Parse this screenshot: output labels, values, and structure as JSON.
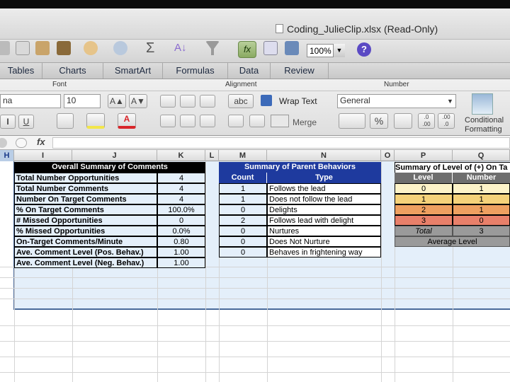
{
  "window": {
    "title": "Coding_JulieClip.xlsx  (Read-Only)"
  },
  "toolbar": {
    "zoom": "100%",
    "help": "?",
    "fx": "fx"
  },
  "tabs": [
    {
      "label": "Tables"
    },
    {
      "label": "Charts"
    },
    {
      "label": "SmartArt"
    },
    {
      "label": "Formulas"
    },
    {
      "label": "Data"
    },
    {
      "label": "Review"
    }
  ],
  "ribbon": {
    "groups": {
      "font": "Font",
      "alignment": "Alignment",
      "number": "Number"
    },
    "font_name": "na",
    "font_size": "10",
    "wrap_text": "Wrap Text",
    "merge": "Merge",
    "number_format": "General",
    "abc": "abc",
    "percent": "%",
    "conditional_formatting_1": "Conditional",
    "conditional_formatting_2": "Formatting",
    "dec1": ".0\n.00",
    "dec2": ".00\n.0"
  },
  "formula_bar": {
    "fx": "fx"
  },
  "columns": [
    "H",
    "I",
    "J",
    "K",
    "L",
    "M",
    "N",
    "O",
    "P",
    "Q"
  ],
  "summary_comments": {
    "title": "Overall Summary of Comments",
    "rows": [
      {
        "label": "Total Number Opportunities",
        "value": "4"
      },
      {
        "label": "Total Number Comments",
        "value": "4"
      },
      {
        "label": "Number On Target Comments",
        "value": "4"
      },
      {
        "label": "% On Target Comments",
        "value": "100.0%"
      },
      {
        "label": "# Missed Opportunities",
        "value": "0"
      },
      {
        "label": "% Missed Opportunities",
        "value": "0.0%"
      },
      {
        "label": "On-Target Comments/Minute",
        "value": "0.80"
      },
      {
        "label": "Ave. Comment Level (Pos. Behav.)",
        "value": "1.00"
      },
      {
        "label": "Ave. Comment Level (Neg. Behav.)",
        "value": "1.00"
      }
    ]
  },
  "parent_behaviors": {
    "title": "Summary of Parent Behaviors",
    "col_count": "Count",
    "col_type": "Type",
    "rows": [
      {
        "count": "1",
        "type": "Follows the lead"
      },
      {
        "count": "1",
        "type": "Does not follow the lead"
      },
      {
        "count": "0",
        "type": "Delights"
      },
      {
        "count": "2",
        "type": "Follows lead with delight"
      },
      {
        "count": "0",
        "type": "Nurtures"
      },
      {
        "count": "0",
        "type": "Does Not Nurture"
      },
      {
        "count": "0",
        "type": "Behaves in frightening way"
      }
    ]
  },
  "level_summary": {
    "title": "Summary of Level of (+) On Ta",
    "col_level": "Level",
    "col_number": "Number",
    "rows": [
      {
        "level": "0",
        "number": "1",
        "color": "#fdf3c8"
      },
      {
        "level": "1",
        "number": "1",
        "color": "#f5d27a"
      },
      {
        "level": "2",
        "number": "1",
        "color": "#eea060"
      },
      {
        "level": "3",
        "number": "0",
        "color": "#e8806a"
      }
    ],
    "total_label": "Total",
    "total_value": "3",
    "average_label": "Average Level"
  }
}
